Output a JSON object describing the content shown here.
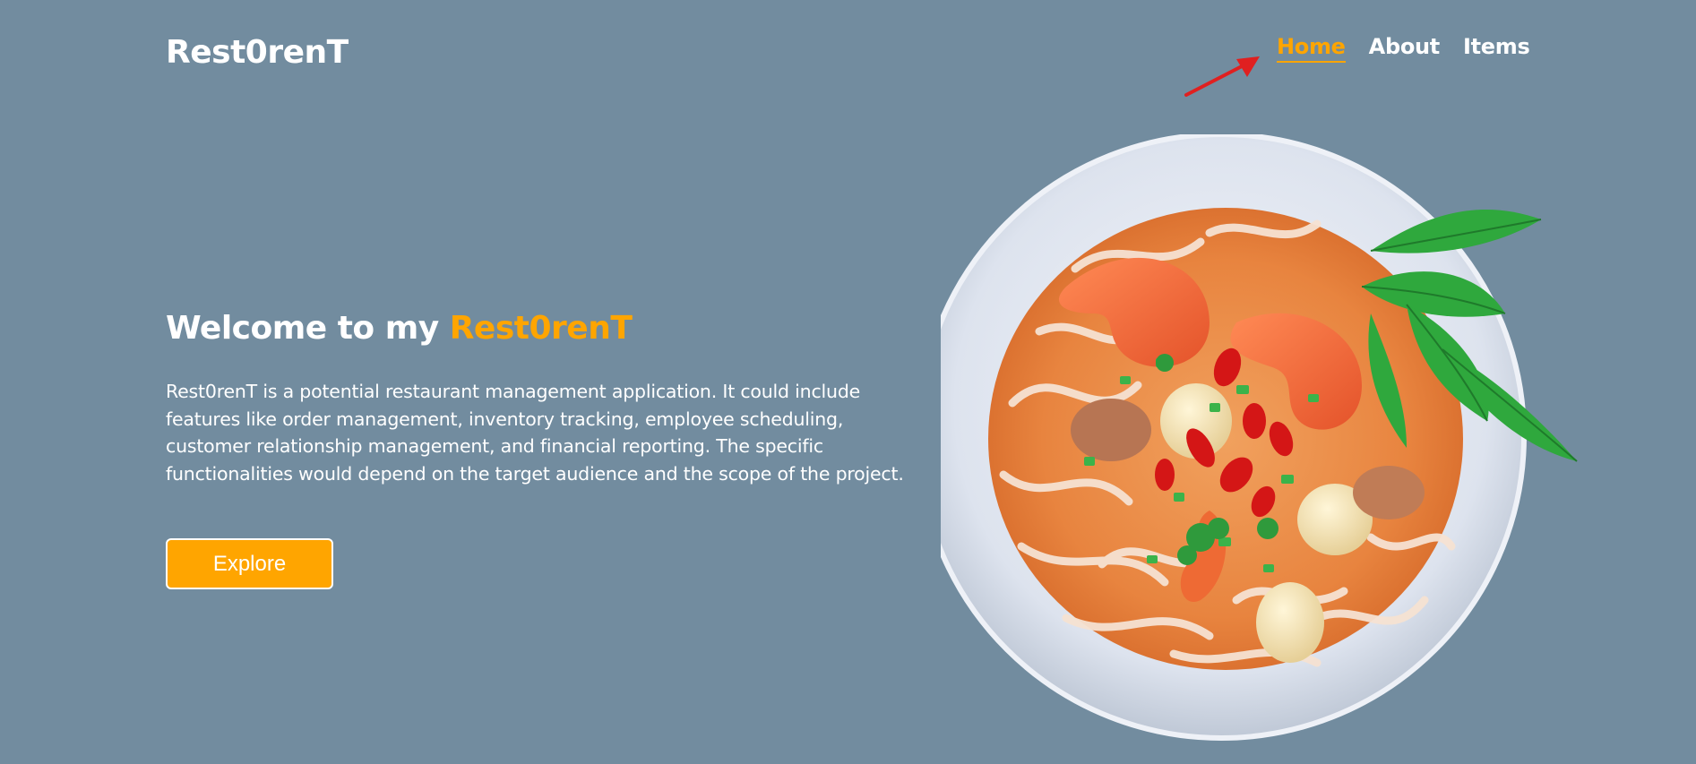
{
  "header": {
    "logo": "Rest0renT",
    "nav": [
      {
        "label": "Home",
        "active": true
      },
      {
        "label": "About",
        "active": false
      },
      {
        "label": "Items",
        "active": false
      }
    ]
  },
  "hero": {
    "title_prefix": "Welcome to my ",
    "title_brand": "Rest0renT",
    "description": "Rest0renT is a potential restaurant management application. It could include features like order management, inventory tracking, employee scheduling, customer relationship management, and financial reporting. The specific functionalities would depend on the target audience and the scope of the project.",
    "button_label": "Explore"
  },
  "image": {
    "subject": "noodle-soup-bowl"
  },
  "colors": {
    "background": "#728c9f",
    "accent": "#ffa500",
    "text": "#ffffff",
    "annotation_arrow": "#e02020"
  }
}
